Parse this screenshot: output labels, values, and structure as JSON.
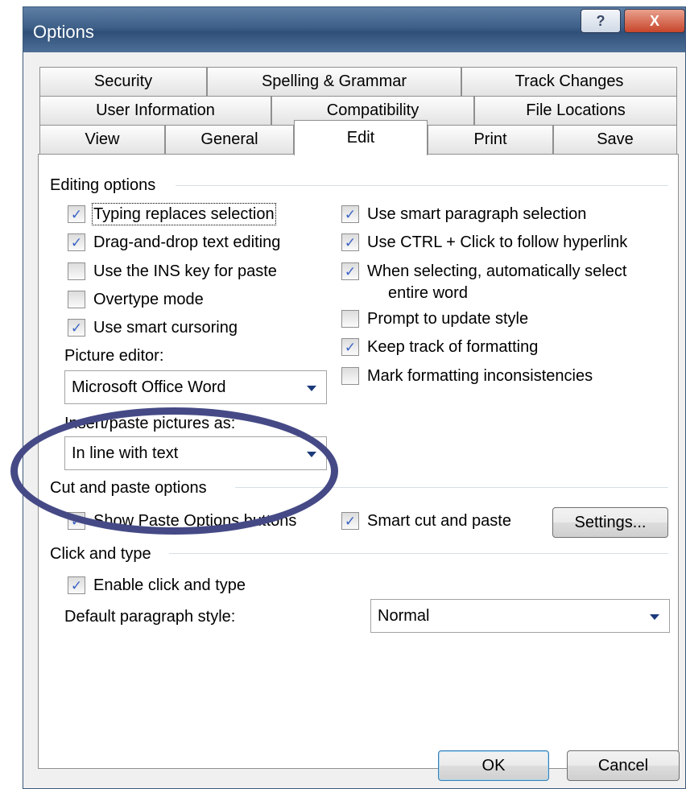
{
  "window": {
    "title": "Options",
    "help_label": "?",
    "close_label": "X"
  },
  "tabs": {
    "row1": [
      {
        "label": "Security"
      },
      {
        "label": "Spelling & Grammar"
      },
      {
        "label": "Track Changes"
      }
    ],
    "row2": [
      {
        "label": "User Information"
      },
      {
        "label": "Compatibility"
      },
      {
        "label": "File Locations"
      }
    ],
    "row3": [
      {
        "label": "View"
      },
      {
        "label": "General"
      },
      {
        "label": "Edit",
        "active": true
      },
      {
        "label": "Print"
      },
      {
        "label": "Save"
      }
    ]
  },
  "editing": {
    "header": "Editing options",
    "typing_replaces": {
      "label": "Typing replaces selection",
      "checked": true
    },
    "drag_drop": {
      "label": "Drag-and-drop text editing",
      "checked": true
    },
    "ins_key": {
      "label": "Use the INS key for paste",
      "checked": false
    },
    "overtype": {
      "label": "Overtype mode",
      "checked": false
    },
    "smart_cursoring": {
      "label": "Use smart cursoring",
      "checked": true
    },
    "picture_editor_label": "Picture editor:",
    "picture_editor_value": "Microsoft Office Word",
    "insert_paste_label": "Insert/paste pictures as:",
    "insert_paste_value": "In line with text",
    "smart_paragraph": {
      "label": "Use smart paragraph selection",
      "checked": true
    },
    "ctrl_click": {
      "label": "Use CTRL + Click to follow hyperlink",
      "checked": true
    },
    "auto_select_word": {
      "label_line1": "When selecting, automatically select",
      "label_line2": "entire word",
      "checked": true
    },
    "prompt_update_style": {
      "label": "Prompt to update style",
      "checked": false
    },
    "keep_track_formatting": {
      "label": "Keep track of formatting",
      "checked": true
    },
    "mark_inconsistencies": {
      "label": "Mark formatting inconsistencies",
      "checked": false
    }
  },
  "cut_paste": {
    "header": "Cut and paste options",
    "show_paste_options": {
      "label": "Show Paste Options buttons",
      "checked": true
    },
    "smart_cut_paste": {
      "label": "Smart cut and paste",
      "checked": true
    },
    "settings_label": "Settings..."
  },
  "click_type": {
    "header": "Click and type",
    "enable": {
      "label": "Enable click and type",
      "checked": true
    },
    "default_style_label": "Default paragraph style:",
    "default_style_value": "Normal"
  },
  "footer": {
    "ok_label": "OK",
    "cancel_label": "Cancel"
  },
  "check_glyph": "✓",
  "colors": {
    "checkmark": "#3b63c4",
    "highlight": "#454a86"
  }
}
